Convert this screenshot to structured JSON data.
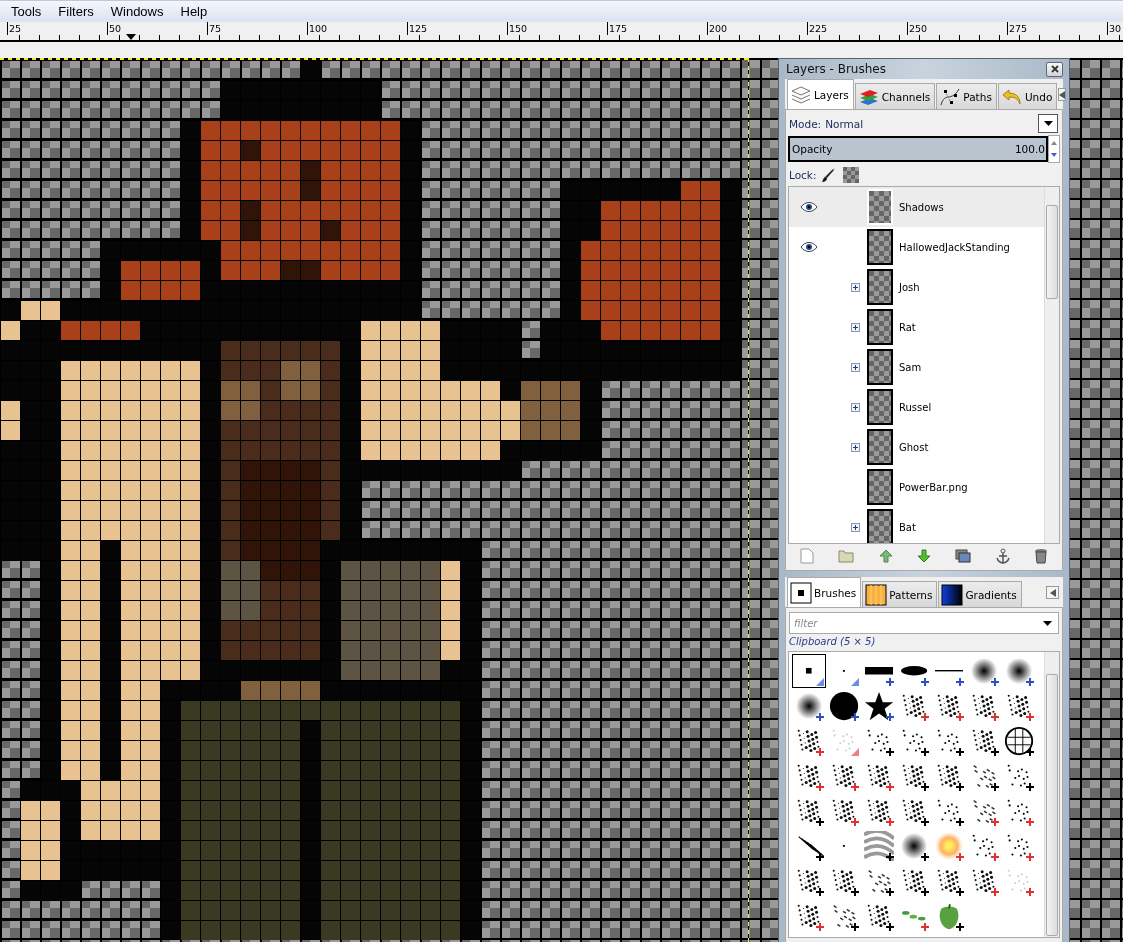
{
  "menu": [
    {
      "label": "Tools"
    },
    {
      "label": "Filters"
    },
    {
      "label": "Windows"
    },
    {
      "label": "Help"
    }
  ],
  "ruler": {
    "labels": [
      "25",
      "50",
      "75",
      "100",
      "125",
      "150",
      "175",
      "200",
      "225",
      "250",
      "275",
      "30"
    ]
  },
  "dock": {
    "title": "Layers - Brushes",
    "layer_tabs": [
      {
        "label": "Layers",
        "kind": "layers",
        "selected": true
      },
      {
        "label": "Channels",
        "kind": "channels",
        "selected": false
      },
      {
        "label": "Paths",
        "kind": "paths",
        "selected": false
      },
      {
        "label": "Undo",
        "kind": "undo",
        "selected": false
      }
    ],
    "mode": {
      "label": "Mode:",
      "value": "Normal"
    },
    "opacity": {
      "label": "Opacity",
      "reading": "100.0",
      "level": 1
    },
    "lock": {
      "label": "Lock:"
    },
    "layers": [
      {
        "name": "Shadows",
        "kind": "layer",
        "visible": true,
        "selected": true
      },
      {
        "name": "HallowedJackStanding",
        "kind": "layer",
        "visible": true,
        "selected": false
      },
      {
        "name": "Josh",
        "kind": "group",
        "expanded": false,
        "visible": false,
        "selected": false
      },
      {
        "name": "Rat",
        "kind": "group",
        "expanded": false,
        "visible": false,
        "selected": false
      },
      {
        "name": "Sam",
        "kind": "group",
        "expanded": false,
        "visible": false,
        "selected": false
      },
      {
        "name": "Russel",
        "kind": "group",
        "expanded": false,
        "visible": false,
        "selected": false
      },
      {
        "name": "Ghost",
        "kind": "group",
        "expanded": false,
        "visible": false,
        "selected": false
      },
      {
        "name": "PowerBar.png",
        "kind": "layer",
        "visible": false,
        "selected": false
      },
      {
        "name": "Bat",
        "kind": "group",
        "expanded": false,
        "visible": false,
        "selected": false
      }
    ],
    "brush_tabs": [
      {
        "label": "Brushes",
        "kind": "brushes",
        "selected": true
      },
      {
        "label": "Patterns",
        "kind": "patterns",
        "selected": false
      },
      {
        "label": "Gradients",
        "kind": "gradients",
        "selected": false
      }
    ],
    "filter": {
      "placeholder": "filter"
    },
    "brush_set": "Clipboard (5 × 5)",
    "brushes": [
      {
        "kind": "square",
        "corner": true,
        "color": "#6a8cf0",
        "selected": true
      },
      {
        "kind": "dot",
        "corner": true,
        "color": "#6a8cf0",
        "selected": false
      },
      {
        "kind": "bar",
        "corner": false,
        "color": "#3050c0",
        "selected": false
      },
      {
        "kind": "ellipse",
        "corner": false,
        "color": "#3050c0",
        "selected": false
      },
      {
        "kind": "line",
        "corner": false,
        "color": "#3050c0",
        "selected": false
      },
      {
        "kind": "soft",
        "corner": false,
        "color": "#3050c0",
        "selected": false
      },
      {
        "kind": "soft",
        "corner": false,
        "color": "#3050c0",
        "selected": false
      },
      {
        "kind": "soft",
        "corner": false,
        "color": "#3050c0",
        "selected": false
      },
      {
        "kind": "circle",
        "corner": false,
        "color": "#3050c0",
        "selected": false
      },
      {
        "kind": "star",
        "corner": false,
        "color": "#3050c0",
        "selected": false
      },
      {
        "kind": "splatter",
        "corner": false,
        "color": "#e03030",
        "selected": false
      },
      {
        "kind": "splatter",
        "corner": false,
        "color": "#e03030",
        "selected": false
      },
      {
        "kind": "splatter",
        "corner": false,
        "color": "#e03030",
        "selected": false
      },
      {
        "kind": "splatter",
        "corner": false,
        "color": "#e03030",
        "selected": false
      },
      {
        "kind": "splatter",
        "corner": false,
        "color": "#e03030",
        "selected": false
      },
      {
        "kind": "faint",
        "corner": true,
        "color": "#f08080",
        "selected": false
      },
      {
        "kind": "scatter",
        "corner": false,
        "color": "#000000",
        "selected": false
      },
      {
        "kind": "scatter",
        "corner": false,
        "color": "#000000",
        "selected": false
      },
      {
        "kind": "scatter",
        "corner": false,
        "color": "#000000",
        "selected": false
      },
      {
        "kind": "splatter",
        "corner": false,
        "color": "#000000",
        "selected": false
      },
      {
        "kind": "cells",
        "corner": false,
        "color": "#000000",
        "selected": false
      },
      {
        "kind": "splatter",
        "corner": false,
        "color": "#e03030",
        "selected": false
      },
      {
        "kind": "splatter",
        "corner": false,
        "color": "#e03030",
        "selected": false
      },
      {
        "kind": "splatter",
        "corner": false,
        "color": "#e03030",
        "selected": false
      },
      {
        "kind": "splatter",
        "corner": false,
        "color": "#000000",
        "selected": false
      },
      {
        "kind": "splatter",
        "corner": false,
        "color": "#000000",
        "selected": false
      },
      {
        "kind": "strokes",
        "corner": false,
        "color": "#000000",
        "selected": false
      },
      {
        "kind": "scatter",
        "corner": false,
        "color": "#000000",
        "selected": false
      },
      {
        "kind": "splatter",
        "corner": false,
        "color": "#000000",
        "selected": false
      },
      {
        "kind": "splatter",
        "corner": false,
        "color": "#e03030",
        "selected": false
      },
      {
        "kind": "splatter",
        "corner": false,
        "color": "#e03030",
        "selected": false
      },
      {
        "kind": "splatter",
        "corner": false,
        "color": "#000000",
        "selected": false
      },
      {
        "kind": "scatter",
        "corner": false,
        "color": "#000000",
        "selected": false
      },
      {
        "kind": "strokes",
        "corner": false,
        "color": "#e03030",
        "selected": false
      },
      {
        "kind": "scatter",
        "corner": false,
        "color": "#e03030",
        "selected": false
      },
      {
        "kind": "lines",
        "corner": false,
        "color": "#000000",
        "selected": false
      },
      {
        "kind": "dot",
        "selected": false
      },
      {
        "kind": "texture",
        "corner": false,
        "color": "#000000",
        "selected": false
      },
      {
        "kind": "soft",
        "corner": false,
        "color": "#000000",
        "selected": false
      },
      {
        "kind": "glow",
        "corner": false,
        "color": "#e03030",
        "selected": false
      },
      {
        "kind": "scatter",
        "corner": false,
        "color": "#e03030",
        "selected": false
      },
      {
        "kind": "scatter",
        "corner": false,
        "color": "#e03030",
        "selected": false
      },
      {
        "kind": "splatter",
        "corner": false,
        "color": "#000000",
        "selected": false
      },
      {
        "kind": "splatter",
        "corner": false,
        "color": "#000000",
        "selected": false
      },
      {
        "kind": "strokes",
        "corner": false,
        "color": "#000000",
        "selected": false
      },
      {
        "kind": "splatter",
        "corner": false,
        "color": "#000000",
        "selected": false
      },
      {
        "kind": "splatter",
        "corner": false,
        "color": "#000000",
        "selected": false
      },
      {
        "kind": "splatter",
        "corner": false,
        "color": "#e03030",
        "selected": false
      },
      {
        "kind": "faint",
        "corner": false,
        "color": "#e03030",
        "selected": false
      },
      {
        "kind": "splatter",
        "corner": false,
        "color": "#e03030",
        "selected": false
      },
      {
        "kind": "burst",
        "corner": false,
        "color": "#000000",
        "selected": false
      },
      {
        "kind": "splatter",
        "corner": false,
        "color": "#000000",
        "selected": false
      },
      {
        "kind": "leaves",
        "corner": false,
        "color": "#e03030",
        "selected": false
      },
      {
        "kind": "pepper",
        "corner": false,
        "color": "#000000",
        "selected": false
      }
    ]
  }
}
